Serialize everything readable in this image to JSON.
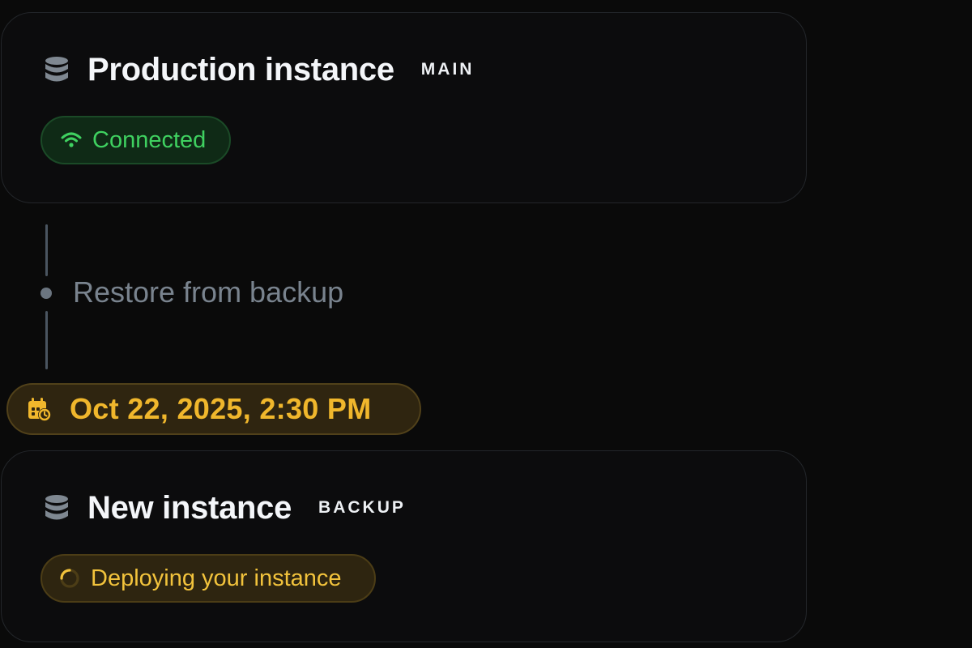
{
  "top_card": {
    "icon": "database-icon",
    "title": "Production instance",
    "tag": "MAIN",
    "status": {
      "icon": "wifi-icon",
      "label": "Connected",
      "color": "#3fd160"
    }
  },
  "timeline": {
    "step_label": "Restore from backup",
    "date": {
      "icon": "calendar-clock-icon",
      "label": "Oct 22, 2025, 2:30 PM",
      "color": "#f0b72c"
    }
  },
  "bottom_card": {
    "icon": "database-icon",
    "title": "New instance",
    "tag": "BACKUP",
    "status": {
      "icon": "spinner-icon",
      "label": "Deploying your instance",
      "color": "#f2c33c"
    }
  }
}
